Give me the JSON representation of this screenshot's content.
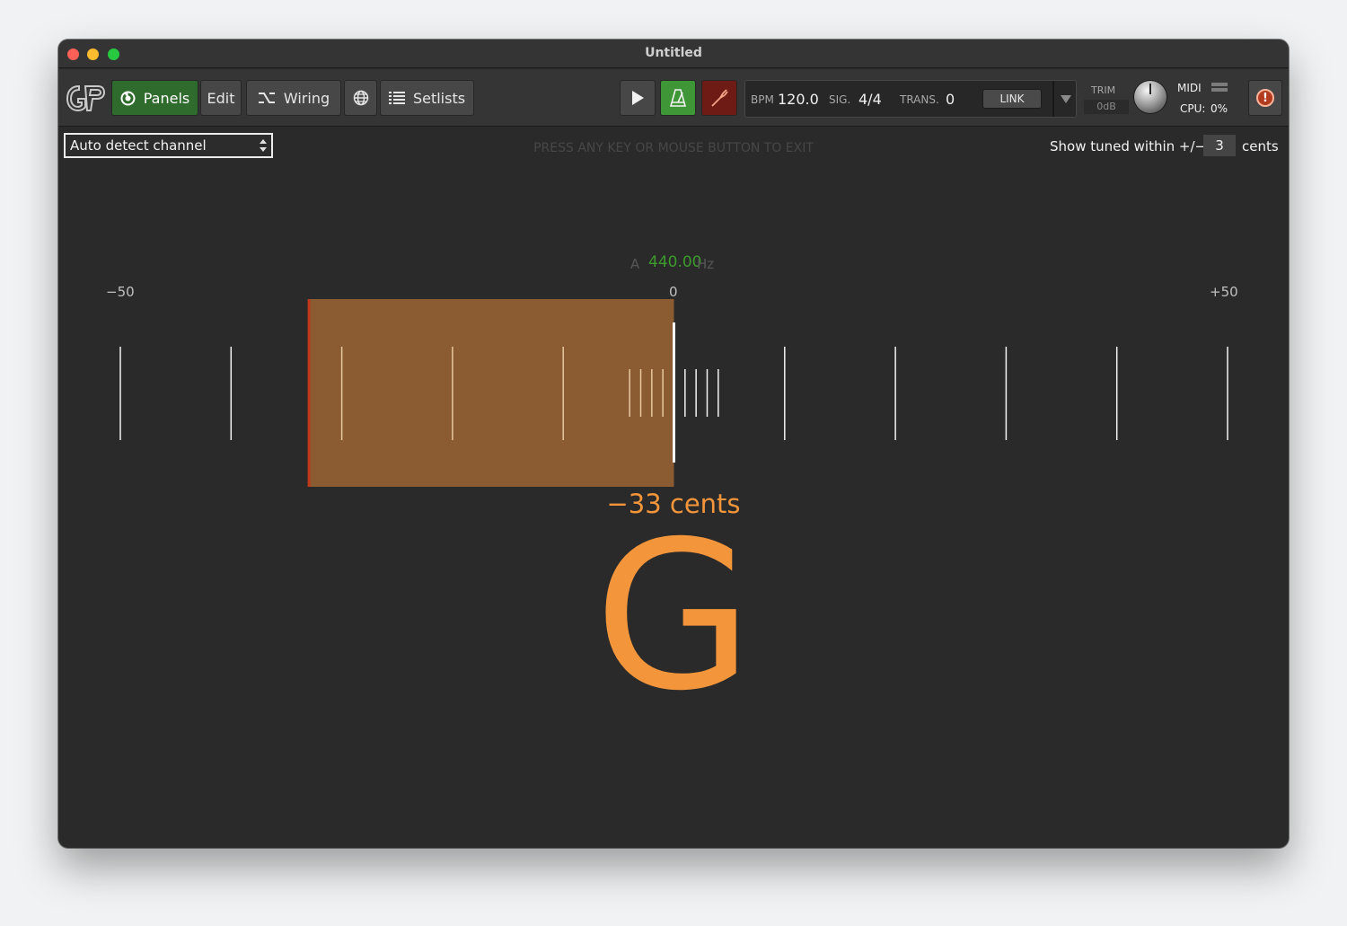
{
  "window": {
    "title": "Untitled"
  },
  "toolbar": {
    "panels_label": "Panels",
    "edit_label": "Edit",
    "wiring_label": "Wiring",
    "setlists_label": "Setlists",
    "bpm_label": "BPM",
    "bpm_value": "120.0",
    "sig_label": "SIG.",
    "sig_value": "4/4",
    "trans_label": "TRANS.",
    "trans_value": "0",
    "link_label": "LINK",
    "trim_label": "TRIM",
    "trim_value": "0dB",
    "midi_label": "MIDI",
    "cpu_label": "CPU:",
    "cpu_value": "0%"
  },
  "tuner": {
    "channel_select": "Auto detect channel",
    "exit_hint": "PRESS ANY KEY OR MOUSE BUTTON TO EXIT",
    "tolerance_label": "Show tuned within +/−",
    "tolerance_value": "3",
    "tolerance_unit": "cents",
    "ref_note": "A",
    "ref_freq": "440.00",
    "ref_unit": "Hz",
    "scale_min": "−50",
    "scale_center": "0",
    "scale_max": "+50",
    "range_min": -50,
    "range_max": 50,
    "deviation_cents": -33,
    "deviation_text": "−33 cents",
    "note": "G"
  },
  "colors": {
    "accent_green": "#2f6b2c",
    "ref_freq_green": "#3c9a2c",
    "deviation_fill": "#8b5c31",
    "deviation_edge": "#c0391b",
    "note_orange": "#f3953a"
  },
  "icons": [
    "panels-icon",
    "wiring-icon",
    "globe-icon",
    "list-icon",
    "play-icon",
    "metronome-icon",
    "tuner-fork-icon",
    "dropdown-arrow-icon",
    "warning-icon"
  ]
}
